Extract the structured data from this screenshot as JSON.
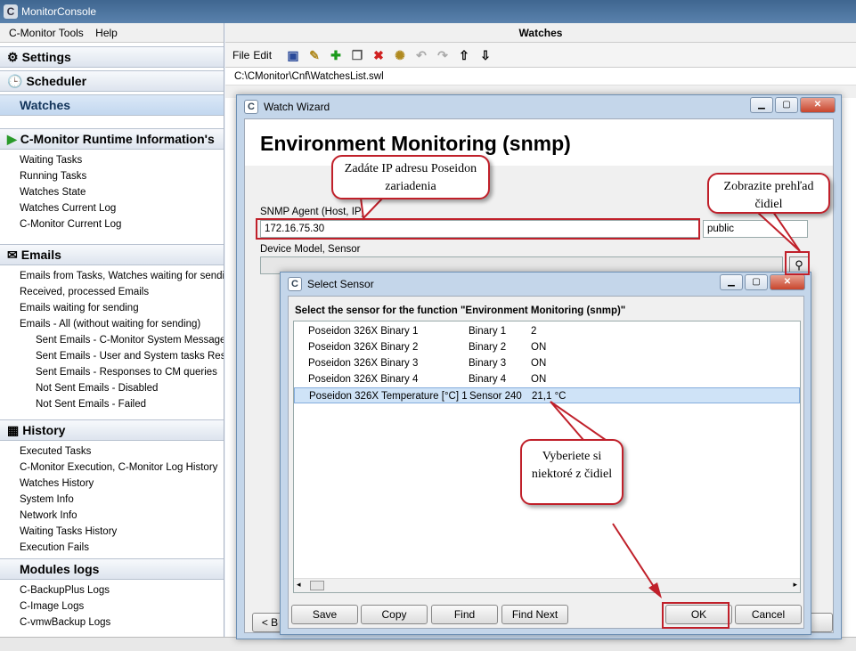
{
  "app": {
    "title": "MonitorConsole"
  },
  "menu": {
    "tools": "C-Monitor Tools",
    "help": "Help"
  },
  "sidebar": {
    "settings": "Settings",
    "scheduler": "Scheduler",
    "watches": "Watches",
    "runtime": {
      "header": "C-Monitor Runtime Information's",
      "items": [
        "Waiting Tasks",
        "Running Tasks",
        "Watches State",
        "Watches Current Log",
        "C-Monitor Current Log"
      ]
    },
    "emails": {
      "header": "Emails",
      "items": [
        "Emails from Tasks, Watches waiting for sending",
        "Received, processed Emails",
        "Emails waiting for sending",
        "Emails - All (without waiting for sending)"
      ],
      "sub_items": [
        "Sent Emails - C-Monitor System Messages",
        "Sent Emails - User and System tasks Results",
        "Sent Emails - Responses to CM queries",
        "Not Sent Emails - Disabled",
        "Not Sent Emails - Failed"
      ]
    },
    "history": {
      "header": "History",
      "items": [
        "Executed Tasks",
        "C-Monitor Execution, C-Monitor Log History",
        "Watches History",
        "System Info",
        "Network Info",
        "Waiting Tasks History",
        "Execution Fails"
      ]
    },
    "modules": {
      "header": "Modules logs",
      "items": [
        "C-BackupPlus Logs",
        "C-Image Logs",
        "C-vmwBackup Logs"
      ]
    }
  },
  "main": {
    "header": "Watches",
    "toolbar": {
      "file": "File",
      "edit": "Edit"
    },
    "path": "C:\\CMonitor\\Cnf\\WatchesList.swl"
  },
  "wizard": {
    "window_title": "Watch Wizard",
    "heading": "Environment Monitoring (snmp)",
    "snmp_agent_label": "SNMP Agent (Host, IP)",
    "snmp_agent_value": "172.16.75.30",
    "community_value": "public",
    "device_label": "Device Model, Sensor",
    "back_button": "< B"
  },
  "sensor_dialog": {
    "window_title": "Select Sensor",
    "heading": "Select the sensor for the function \"Environment Monitoring (snmp)\"",
    "rows": [
      {
        "name": "Poseidon 326X Binary 1",
        "id": "Binary 1",
        "value": "2"
      },
      {
        "name": "Poseidon 326X Binary 2",
        "id": "Binary 2",
        "value": "ON"
      },
      {
        "name": "Poseidon 326X Binary 3",
        "id": "Binary 3",
        "value": "ON"
      },
      {
        "name": "Poseidon 326X Binary 4",
        "id": "Binary 4",
        "value": "ON"
      },
      {
        "name": "Poseidon 326X Temperature [°C] 1",
        "id": "Sensor 240",
        "value": "21,1 °C"
      }
    ],
    "buttons": {
      "save": "Save",
      "copy": "Copy",
      "find": "Find",
      "find_next": "Find Next",
      "ok": "OK",
      "cancel": "Cancel"
    }
  },
  "callouts": {
    "ip": "Zadáte IP adresu Poseidon zariadenia",
    "overview": "Zobrazite prehľad čidiel",
    "select": "Vyberiete si niektoré z čidiel"
  },
  "colors": {
    "highlight": "#c0202a",
    "titlebar": "#4a6f98"
  }
}
